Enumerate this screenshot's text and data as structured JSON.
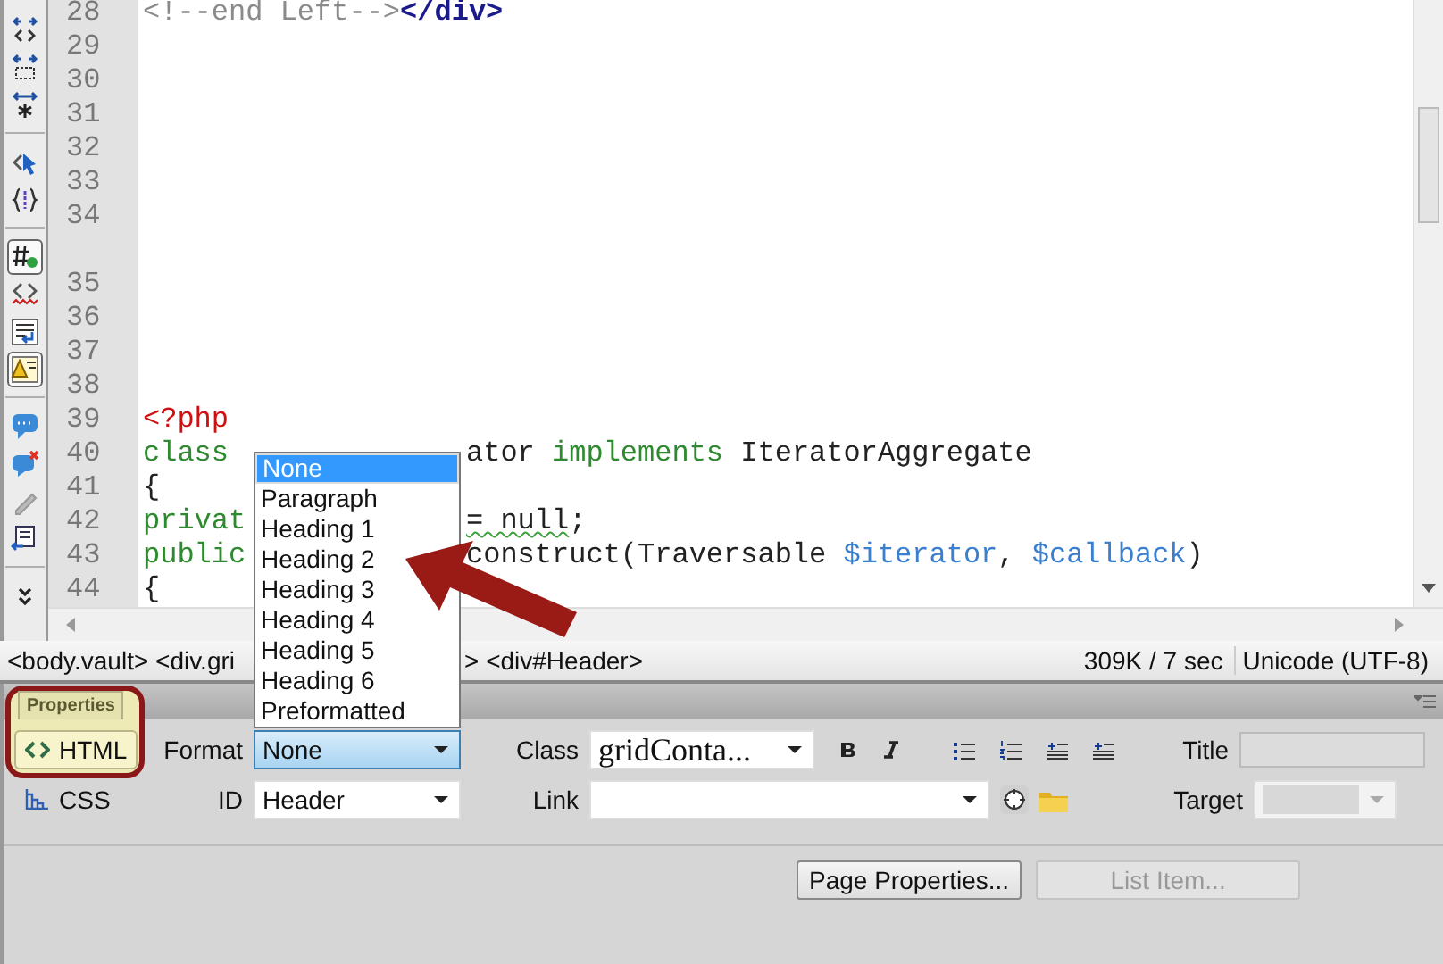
{
  "toolbar": [
    {
      "kind": "collapse-tag",
      "pressed": false
    },
    {
      "kind": "collapse-selection",
      "pressed": false
    },
    {
      "kind": "expand-all",
      "pressed": false
    },
    {
      "kind": "select-parent",
      "pressed": false
    },
    {
      "kind": "balance-braces",
      "pressed": false
    },
    {
      "kind": "line-numbers",
      "pressed": true
    },
    {
      "kind": "highlight-invalid",
      "pressed": false
    },
    {
      "kind": "word-wrap",
      "pressed": false
    },
    {
      "kind": "syntax-warning",
      "pressed": true
    },
    {
      "kind": "apply-comment",
      "pressed": false
    },
    {
      "kind": "remove-comment",
      "pressed": false
    },
    {
      "kind": "wrap-tag",
      "pressed": false
    },
    {
      "kind": "indent",
      "pressed": false
    },
    {
      "kind": "more",
      "pressed": false
    }
  ],
  "code_lines": [
    {
      "number": "28",
      "segments": [
        {
          "kind": "comment",
          "text": "<!--end Left-->"
        },
        {
          "kind": "tag",
          "text": "</div>"
        }
      ]
    },
    {
      "number": "29"
    },
    {
      "number": "30"
    },
    {
      "number": "31"
    },
    {
      "number": "32"
    },
    {
      "number": "33"
    },
    {
      "number": "34",
      "wrapped": true
    },
    {
      "number": "35"
    },
    {
      "number": "36"
    },
    {
      "number": "37"
    },
    {
      "number": "38"
    },
    {
      "number": "39",
      "segments": [
        {
          "kind": "php",
          "text": "<?php"
        }
      ]
    },
    {
      "number": "40",
      "segments": [
        {
          "kind": "keyword",
          "text": "class "
        }
      ],
      "after": [
        {
          "kind": "plain",
          "text": "ator "
        },
        {
          "kind": "keyword",
          "text": "implements "
        },
        {
          "kind": "plain",
          "text": "IteratorAggregate"
        }
      ]
    },
    {
      "number": "41",
      "segments": [
        {
          "kind": "plain",
          "text": "{"
        }
      ]
    },
    {
      "number": "42",
      "segments": [
        {
          "kind": "keyword",
          "text": "privat"
        }
      ],
      "after": [
        {
          "kind": "plain",
          "text": "= null",
          "flagged": true
        },
        {
          "kind": "plain",
          "text": ";"
        }
      ]
    },
    {
      "number": "43",
      "segments": [
        {
          "kind": "keyword",
          "text": "public"
        }
      ],
      "after": [
        {
          "kind": "plain",
          "text": "construct(Traversable "
        },
        {
          "kind": "variable",
          "text": "$iterator"
        },
        {
          "kind": "plain",
          "text": ", "
        },
        {
          "kind": "variable",
          "text": "$callback"
        },
        {
          "kind": "plain",
          "text": ")"
        }
      ]
    },
    {
      "number": "44",
      "segments": [
        {
          "kind": "plain",
          "text": "{"
        }
      ]
    }
  ],
  "status_bar": {
    "path_left": "<body.vault> <div.gri",
    "path_right": "> <div#Header>",
    "size": "309K / 7 sec",
    "encoding": "Unicode (UTF-8)"
  },
  "format_menu": {
    "options": [
      {
        "label": "None",
        "selected": true
      },
      {
        "label": "Paragraph",
        "selected": false
      },
      {
        "label": "Heading 1",
        "selected": false
      },
      {
        "label": "Heading 2",
        "selected": false
      },
      {
        "label": "Heading 3",
        "selected": false
      },
      {
        "label": "Heading 4",
        "selected": false
      },
      {
        "label": "Heading 5",
        "selected": false
      },
      {
        "label": "Heading 6",
        "selected": false
      },
      {
        "label": "Preformatted",
        "selected": false
      }
    ]
  },
  "properties": {
    "title": "Properties",
    "modes": [
      {
        "label": "HTML",
        "selected": true
      },
      {
        "label": "CSS",
        "selected": false
      }
    ],
    "format": {
      "label": "Format",
      "value": "None",
      "open": true
    },
    "id": {
      "label": "ID",
      "value": "Header"
    },
    "class": {
      "label": "Class",
      "value": "gridConta..."
    },
    "link": {
      "label": "Link"
    },
    "title_field": {
      "label": "Title"
    },
    "target": {
      "label": "Target",
      "disabled": true
    },
    "buttons": [
      {
        "label": "Page Properties...",
        "disabled": false
      },
      {
        "label": "List Item...",
        "disabled": true
      }
    ]
  }
}
